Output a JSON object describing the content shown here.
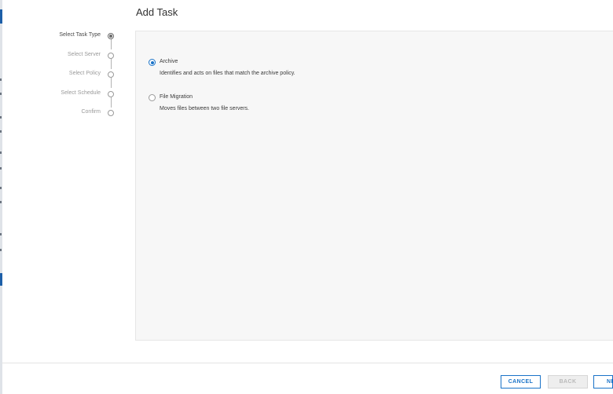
{
  "dialog": {
    "title": "Add Task"
  },
  "steps": [
    {
      "label": "Select Task Type",
      "state": "active"
    },
    {
      "label": "Select Server",
      "state": "pending"
    },
    {
      "label": "Select Policy",
      "state": "pending"
    },
    {
      "label": "Select Schedule",
      "state": "pending"
    },
    {
      "label": "Confirm",
      "state": "pending"
    }
  ],
  "task_types": [
    {
      "label": "Archive",
      "description": "Identifies and acts on files that match the archive policy.",
      "selected": true
    },
    {
      "label": "File Migration",
      "description": "Moves files between two file servers.",
      "selected": false
    }
  ],
  "footer": {
    "cancel_label": "CANCEL",
    "back_label": "BACK",
    "next_label": "NE"
  },
  "colors": {
    "accent": "#1a73c8",
    "panel_bg": "#f7f7f7",
    "disabled_bg": "#eeeeee"
  }
}
